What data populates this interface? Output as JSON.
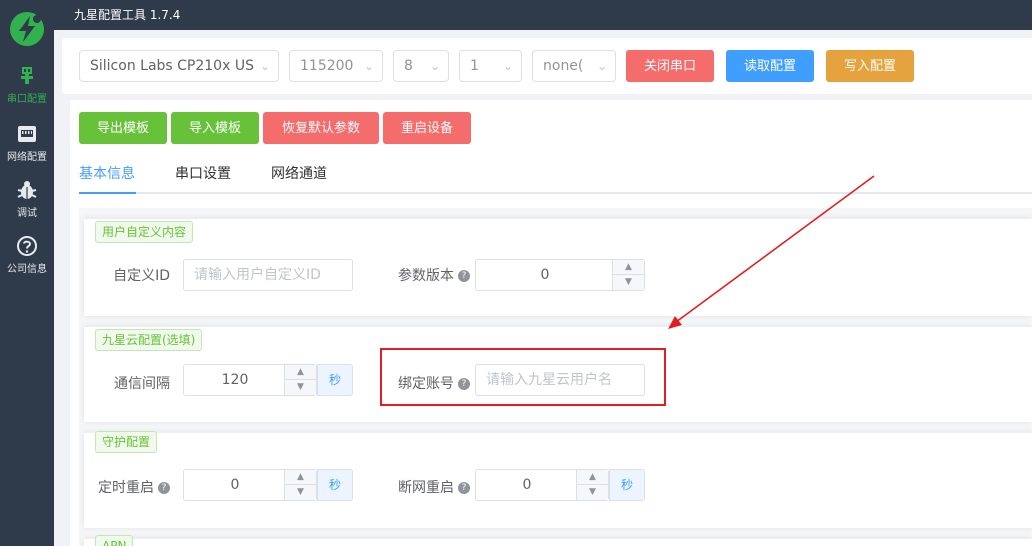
{
  "app": {
    "title": "九星配置工具 1.7.4"
  },
  "sidebar": {
    "items": [
      {
        "label": "串口配置",
        "icon": "usb-plug-icon",
        "active": true
      },
      {
        "label": "网络配置",
        "icon": "network-port-icon",
        "active": false
      },
      {
        "label": "调试",
        "icon": "bug-icon",
        "active": false
      },
      {
        "label": "公司信息",
        "icon": "question-circle-icon",
        "active": false
      }
    ]
  },
  "toolbar": {
    "port": "Silicon Labs CP210x US",
    "baud": "115200",
    "databits": "8",
    "stopbits": "1",
    "parity": "none(",
    "close_port": "关闭串口",
    "read_config": "读取配置",
    "write_config": "写入配置"
  },
  "actions": {
    "export_template": "导出模板",
    "import_template": "导入模板",
    "restore_defaults": "恢复默认参数",
    "restart_device": "重启设备"
  },
  "tabs": [
    "基本信息",
    "串口设置",
    "网络通道"
  ],
  "sections": {
    "user": {
      "title": "用户自定义内容",
      "custom_id_label": "自定义ID",
      "custom_id_placeholder": "请输入用户自定义ID",
      "param_version_label": "参数版本",
      "param_version_value": "0"
    },
    "cloud": {
      "title": "九星云配置(选填)",
      "interval_label": "通信间隔",
      "interval_value": "120",
      "interval_unit": "秒",
      "bind_account_label": "绑定账号",
      "bind_account_placeholder": "请输入九星云用户名"
    },
    "guard": {
      "title": "守护配置",
      "timed_restart_label": "定时重启",
      "timed_restart_value": "0",
      "timed_restart_unit": "秒",
      "disconnect_restart_label": "断网重启",
      "disconnect_restart_value": "0",
      "disconnect_restart_unit": "秒"
    },
    "apn": {
      "title": "APN"
    }
  },
  "colors": {
    "sidebar_bg": "#2f3a4a",
    "accent_green": "#67c23a",
    "accent_blue": "#409eff",
    "danger": "#f56c6c",
    "warning": "#e6a23c",
    "annotation_red": "#e02020"
  }
}
